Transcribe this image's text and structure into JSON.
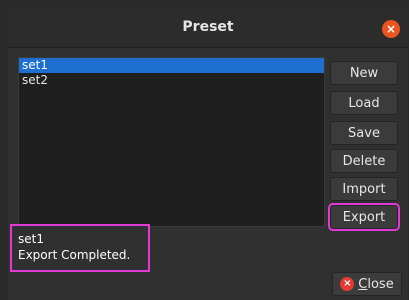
{
  "window": {
    "title": "Preset",
    "close_icon": "close-icon",
    "colors": {
      "accent": "#e95420",
      "selection": "#1e6fd0",
      "highlight": "#e23ad6"
    }
  },
  "list": {
    "items": [
      {
        "label": "set1",
        "selected": true
      },
      {
        "label": "set2",
        "selected": false
      }
    ]
  },
  "buttons": {
    "new": "New",
    "load": "Load",
    "save": "Save",
    "delete": "Delete",
    "import": "Import",
    "export": "Export"
  },
  "status": {
    "line1": "set1",
    "line2": "Export Completed."
  },
  "footer": {
    "close_label_first": "C",
    "close_label_rest": "lose",
    "close_icon": "close-circle-icon"
  }
}
